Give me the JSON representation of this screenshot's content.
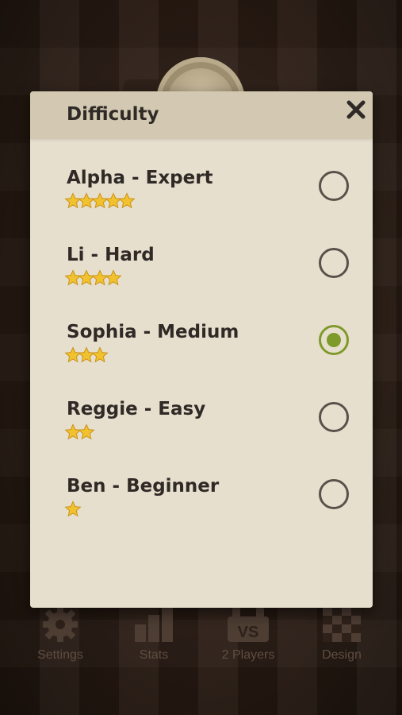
{
  "dialog": {
    "title": "Difficulty",
    "close_icon": "close-icon"
  },
  "options": [
    {
      "label": "Alpha - Expert",
      "stars": 5,
      "selected": false
    },
    {
      "label": "Li - Hard",
      "stars": 4,
      "selected": false
    },
    {
      "label": "Sophia - Medium",
      "stars": 3,
      "selected": true
    },
    {
      "label": "Reggie - Easy",
      "stars": 2,
      "selected": false
    },
    {
      "label": "Ben - Beginner",
      "stars": 1,
      "selected": false
    }
  ],
  "bottom_nav": {
    "settings": {
      "label": "Settings",
      "icon": "gear-icon"
    },
    "stats": {
      "label": "Stats",
      "icon": "bar-chart-icon"
    },
    "players": {
      "label": "2 Players",
      "icon": "versus-icon",
      "icon_text": "VS"
    },
    "design": {
      "label": "Design",
      "icon": "checkerboard-icon"
    }
  },
  "colors": {
    "accent_selected": "#7e9a2a",
    "dialog_bg": "#e7dfce",
    "header_bg": "#d3c9b2",
    "star": "#f2c12e"
  }
}
